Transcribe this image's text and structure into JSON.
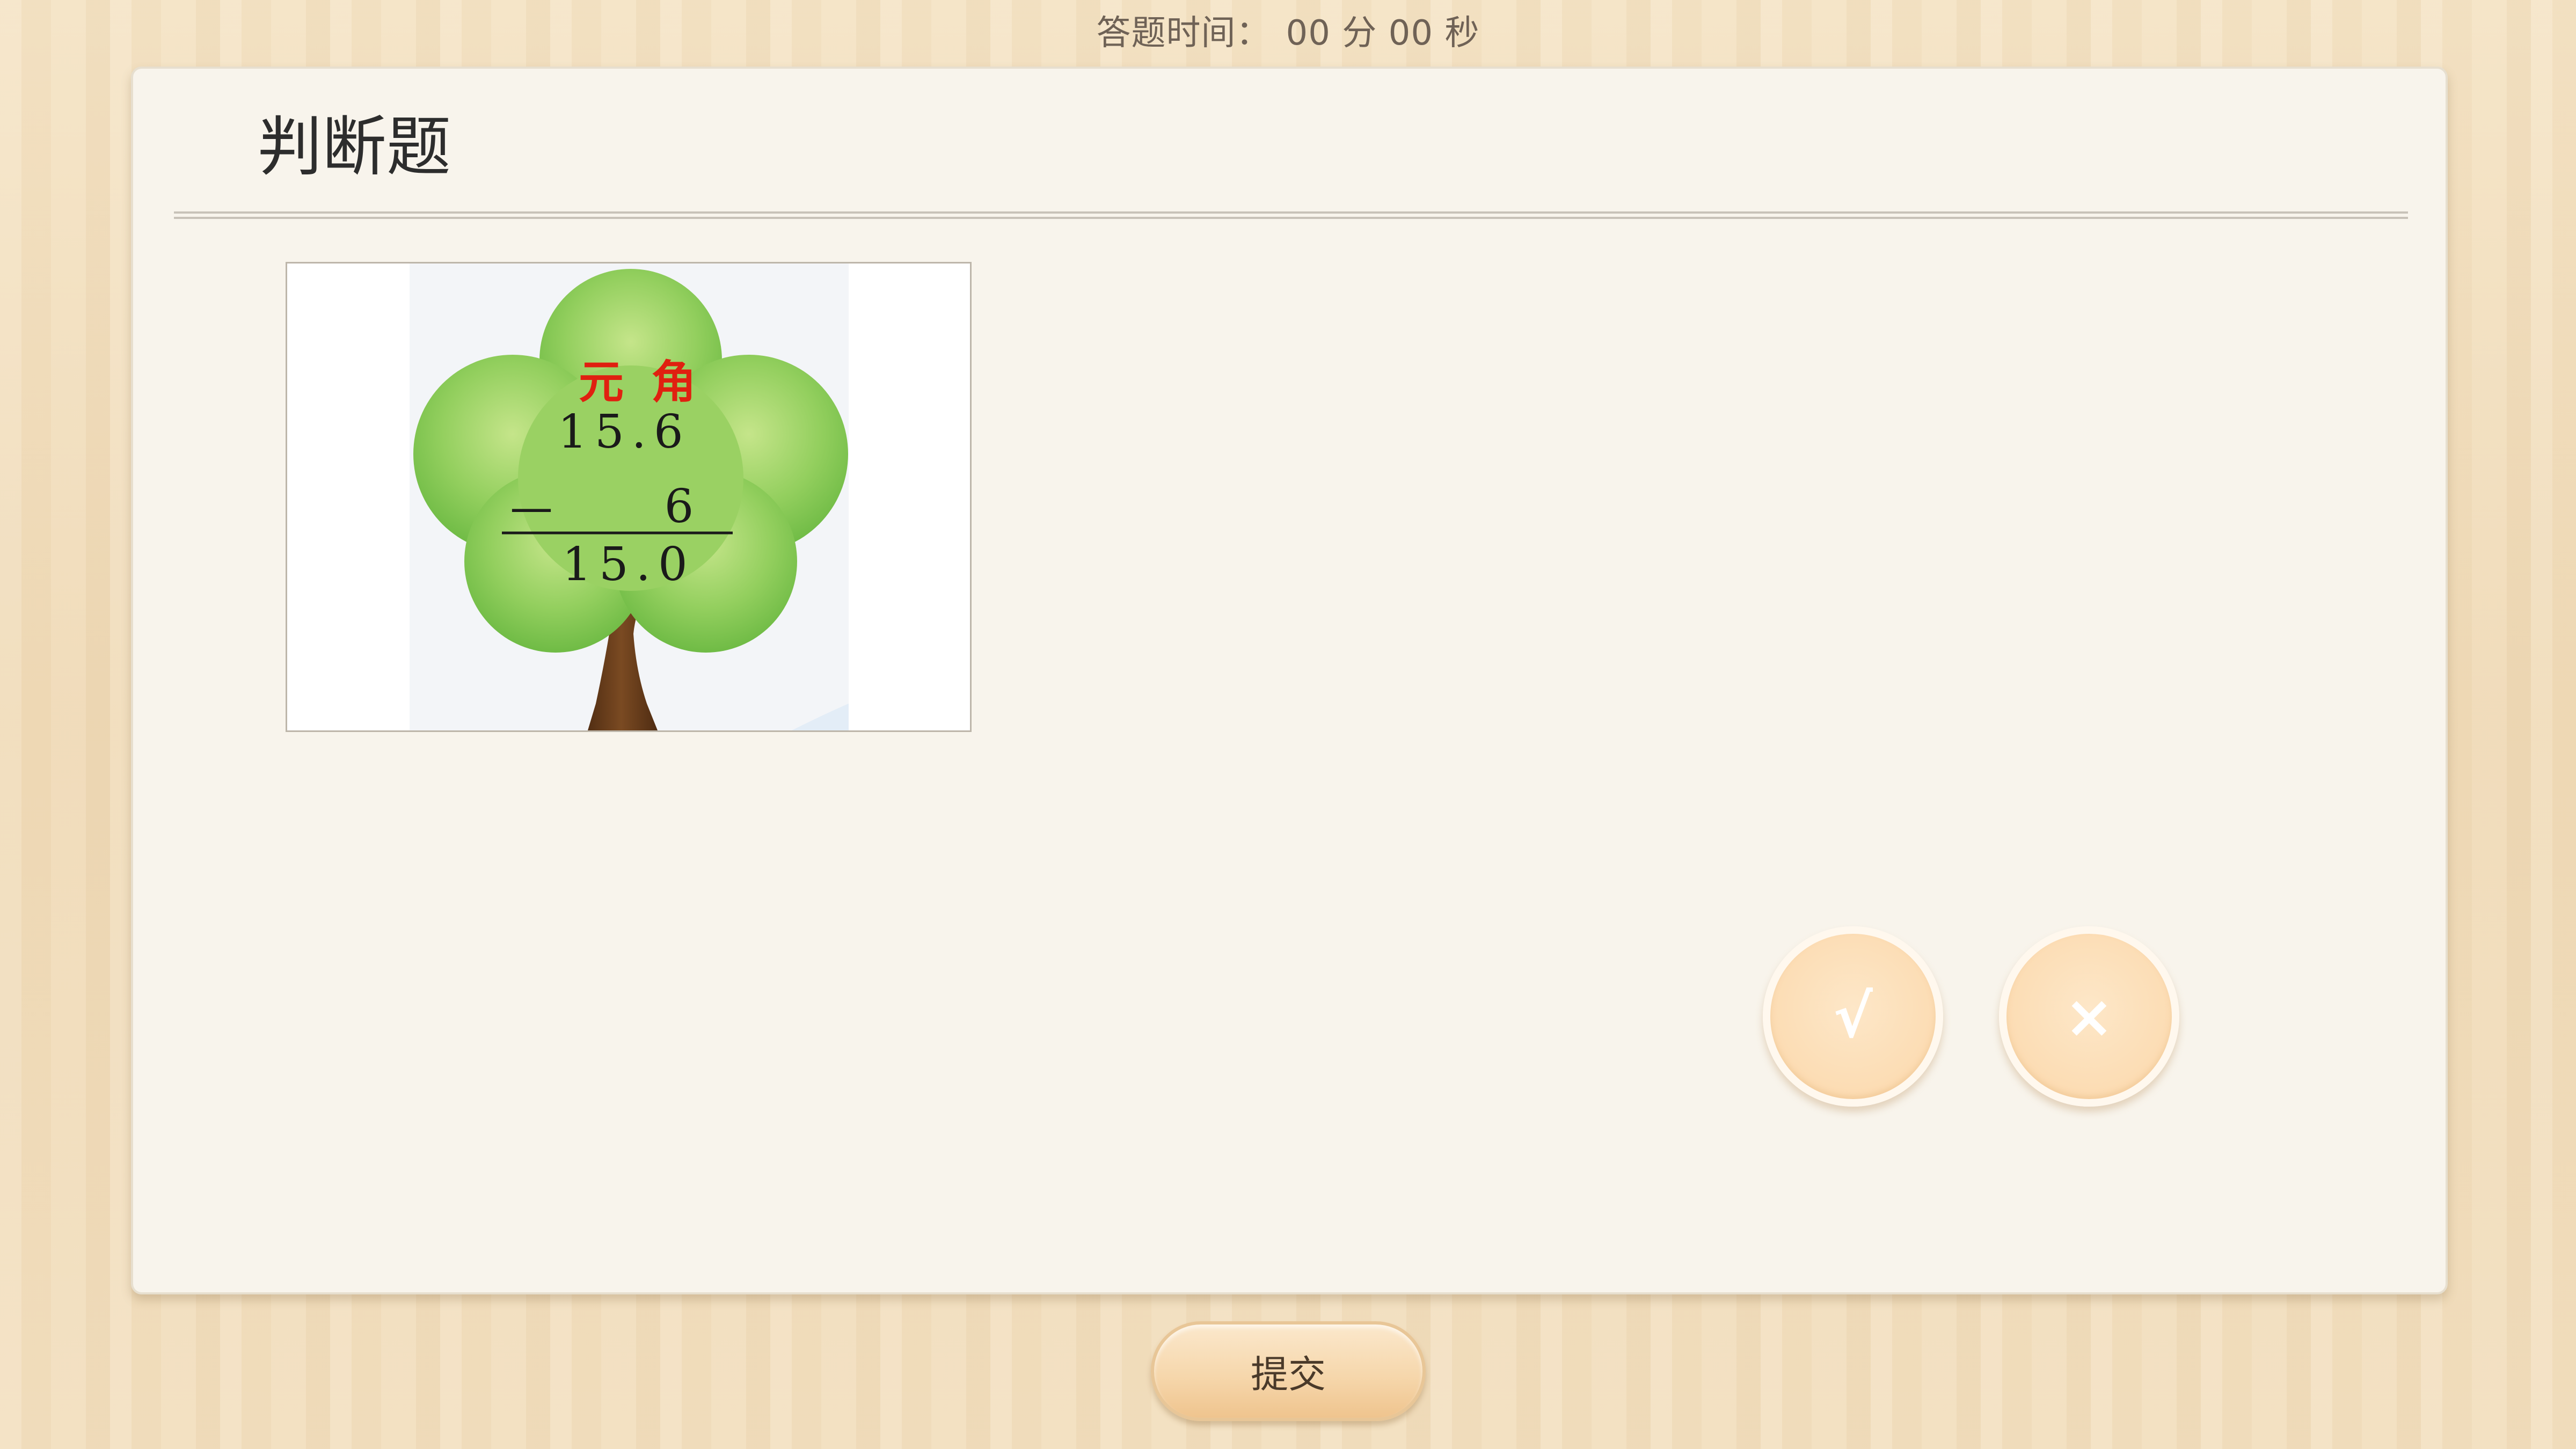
{
  "timer": {
    "label": "答题时间：",
    "minutes": "00",
    "minutes_unit": "分",
    "seconds": "00",
    "seconds_unit": "秒"
  },
  "question": {
    "type_title": "判断题",
    "image": {
      "header_yuan": "元",
      "header_jiao": "角",
      "line1": "15.6",
      "minus_sign": "—",
      "line2": "6",
      "result": "15.0"
    }
  },
  "answers": {
    "true_symbol": "√",
    "false_symbol": "×"
  },
  "footer": {
    "submit_label": "提交"
  },
  "colors": {
    "card_bg": "#f8f4ec",
    "answer_button": "#fcdcb3",
    "header_red": "#e02010",
    "tree_green": "#8ccc58",
    "trunk_brown": "#6b3f1d"
  },
  "icons": {
    "tree": "tree-illustration"
  }
}
